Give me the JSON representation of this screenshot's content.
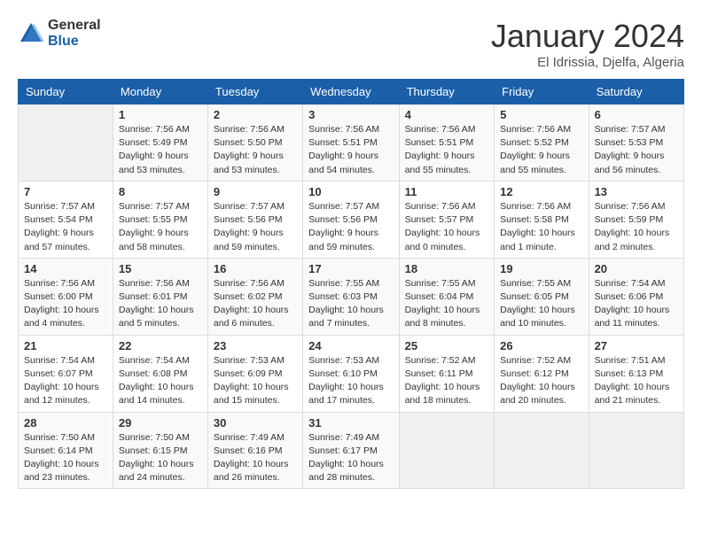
{
  "logo": {
    "general": "General",
    "blue": "Blue"
  },
  "title": "January 2024",
  "subtitle": "El Idrissia, Djelfa, Algeria",
  "headers": [
    "Sunday",
    "Monday",
    "Tuesday",
    "Wednesday",
    "Thursday",
    "Friday",
    "Saturday"
  ],
  "weeks": [
    [
      {
        "day": "",
        "info": ""
      },
      {
        "day": "1",
        "info": "Sunrise: 7:56 AM\nSunset: 5:49 PM\nDaylight: 9 hours\nand 53 minutes."
      },
      {
        "day": "2",
        "info": "Sunrise: 7:56 AM\nSunset: 5:50 PM\nDaylight: 9 hours\nand 53 minutes."
      },
      {
        "day": "3",
        "info": "Sunrise: 7:56 AM\nSunset: 5:51 PM\nDaylight: 9 hours\nand 54 minutes."
      },
      {
        "day": "4",
        "info": "Sunrise: 7:56 AM\nSunset: 5:51 PM\nDaylight: 9 hours\nand 55 minutes."
      },
      {
        "day": "5",
        "info": "Sunrise: 7:56 AM\nSunset: 5:52 PM\nDaylight: 9 hours\nand 55 minutes."
      },
      {
        "day": "6",
        "info": "Sunrise: 7:57 AM\nSunset: 5:53 PM\nDaylight: 9 hours\nand 56 minutes."
      }
    ],
    [
      {
        "day": "7",
        "info": "Sunrise: 7:57 AM\nSunset: 5:54 PM\nDaylight: 9 hours\nand 57 minutes."
      },
      {
        "day": "8",
        "info": "Sunrise: 7:57 AM\nSunset: 5:55 PM\nDaylight: 9 hours\nand 58 minutes."
      },
      {
        "day": "9",
        "info": "Sunrise: 7:57 AM\nSunset: 5:56 PM\nDaylight: 9 hours\nand 59 minutes."
      },
      {
        "day": "10",
        "info": "Sunrise: 7:57 AM\nSunset: 5:56 PM\nDaylight: 9 hours\nand 59 minutes."
      },
      {
        "day": "11",
        "info": "Sunrise: 7:56 AM\nSunset: 5:57 PM\nDaylight: 10 hours\nand 0 minutes."
      },
      {
        "day": "12",
        "info": "Sunrise: 7:56 AM\nSunset: 5:58 PM\nDaylight: 10 hours\nand 1 minute."
      },
      {
        "day": "13",
        "info": "Sunrise: 7:56 AM\nSunset: 5:59 PM\nDaylight: 10 hours\nand 2 minutes."
      }
    ],
    [
      {
        "day": "14",
        "info": "Sunrise: 7:56 AM\nSunset: 6:00 PM\nDaylight: 10 hours\nand 4 minutes."
      },
      {
        "day": "15",
        "info": "Sunrise: 7:56 AM\nSunset: 6:01 PM\nDaylight: 10 hours\nand 5 minutes."
      },
      {
        "day": "16",
        "info": "Sunrise: 7:56 AM\nSunset: 6:02 PM\nDaylight: 10 hours\nand 6 minutes."
      },
      {
        "day": "17",
        "info": "Sunrise: 7:55 AM\nSunset: 6:03 PM\nDaylight: 10 hours\nand 7 minutes."
      },
      {
        "day": "18",
        "info": "Sunrise: 7:55 AM\nSunset: 6:04 PM\nDaylight: 10 hours\nand 8 minutes."
      },
      {
        "day": "19",
        "info": "Sunrise: 7:55 AM\nSunset: 6:05 PM\nDaylight: 10 hours\nand 10 minutes."
      },
      {
        "day": "20",
        "info": "Sunrise: 7:54 AM\nSunset: 6:06 PM\nDaylight: 10 hours\nand 11 minutes."
      }
    ],
    [
      {
        "day": "21",
        "info": "Sunrise: 7:54 AM\nSunset: 6:07 PM\nDaylight: 10 hours\nand 12 minutes."
      },
      {
        "day": "22",
        "info": "Sunrise: 7:54 AM\nSunset: 6:08 PM\nDaylight: 10 hours\nand 14 minutes."
      },
      {
        "day": "23",
        "info": "Sunrise: 7:53 AM\nSunset: 6:09 PM\nDaylight: 10 hours\nand 15 minutes."
      },
      {
        "day": "24",
        "info": "Sunrise: 7:53 AM\nSunset: 6:10 PM\nDaylight: 10 hours\nand 17 minutes."
      },
      {
        "day": "25",
        "info": "Sunrise: 7:52 AM\nSunset: 6:11 PM\nDaylight: 10 hours\nand 18 minutes."
      },
      {
        "day": "26",
        "info": "Sunrise: 7:52 AM\nSunset: 6:12 PM\nDaylight: 10 hours\nand 20 minutes."
      },
      {
        "day": "27",
        "info": "Sunrise: 7:51 AM\nSunset: 6:13 PM\nDaylight: 10 hours\nand 21 minutes."
      }
    ],
    [
      {
        "day": "28",
        "info": "Sunrise: 7:50 AM\nSunset: 6:14 PM\nDaylight: 10 hours\nand 23 minutes."
      },
      {
        "day": "29",
        "info": "Sunrise: 7:50 AM\nSunset: 6:15 PM\nDaylight: 10 hours\nand 24 minutes."
      },
      {
        "day": "30",
        "info": "Sunrise: 7:49 AM\nSunset: 6:16 PM\nDaylight: 10 hours\nand 26 minutes."
      },
      {
        "day": "31",
        "info": "Sunrise: 7:49 AM\nSunset: 6:17 PM\nDaylight: 10 hours\nand 28 minutes."
      },
      {
        "day": "",
        "info": ""
      },
      {
        "day": "",
        "info": ""
      },
      {
        "day": "",
        "info": ""
      }
    ]
  ]
}
